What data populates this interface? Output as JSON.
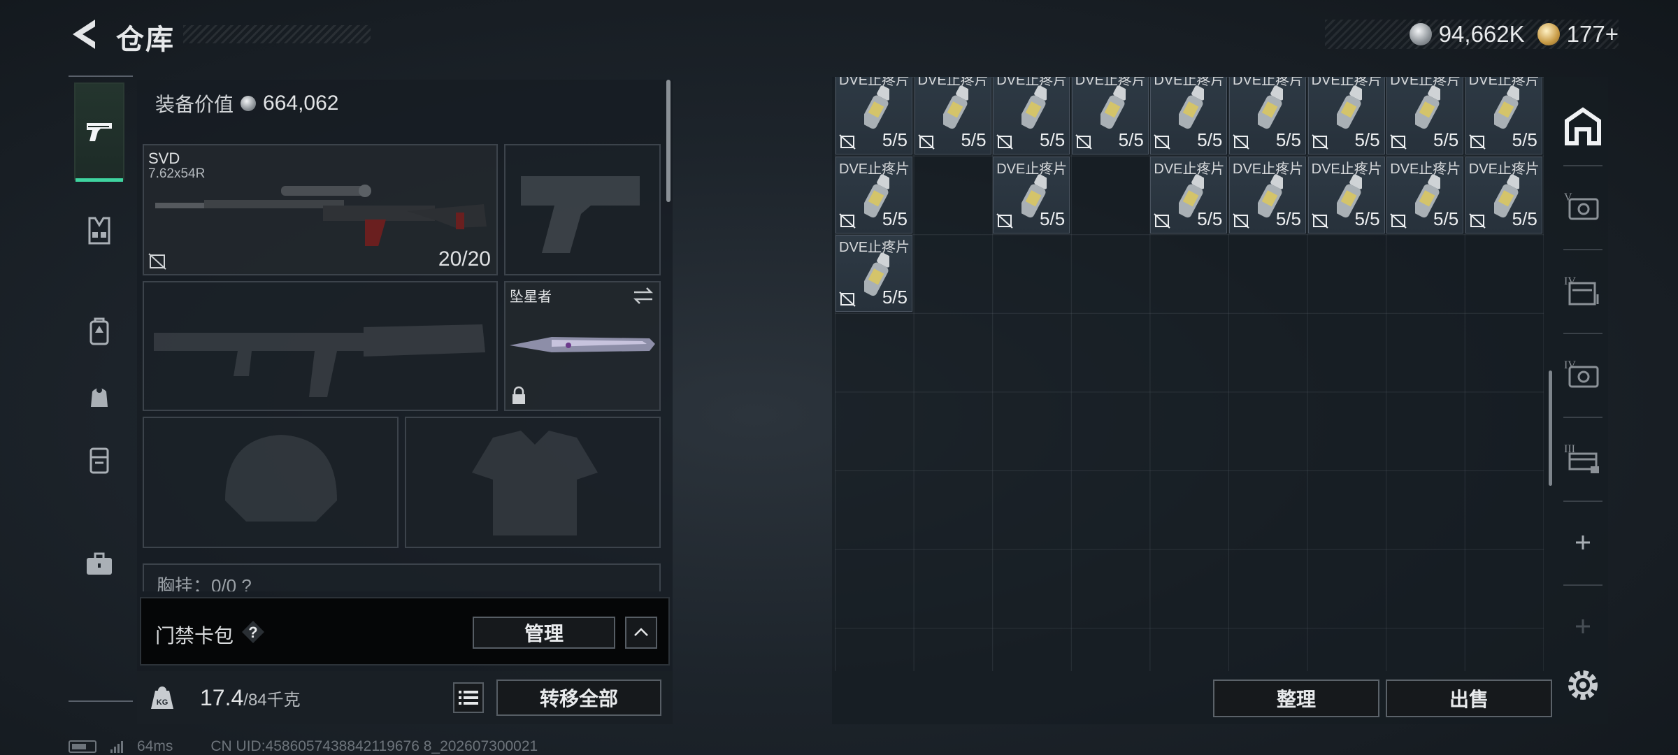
{
  "header": {
    "title": "仓库",
    "currencies": [
      {
        "name": "silver-coin",
        "value": "94,662K"
      },
      {
        "name": "gold-coin",
        "value": "177+"
      }
    ]
  },
  "left_tabs": [
    {
      "name": "weapons",
      "icon": "pistol-icon",
      "active": true
    },
    {
      "name": "armor",
      "icon": "vest-icon",
      "active": false
    },
    {
      "name": "backpack",
      "icon": "backpack-icon",
      "active": false
    },
    {
      "name": "bag",
      "icon": "pouch-icon",
      "active": false
    },
    {
      "name": "container",
      "icon": "case-icon",
      "active": false
    },
    {
      "name": "briefcase",
      "icon": "briefcase-icon",
      "active": false
    }
  ],
  "equipment": {
    "value_label": "装备价值",
    "value": "664,062",
    "primary": {
      "name": "SVD",
      "caliber": "7.62x54R",
      "ammo": "20/20"
    },
    "melee": {
      "name": "坠星者"
    },
    "chest_rig_label": "胸挂：0/0 ?"
  },
  "keycard": {
    "label": "门禁卡包",
    "help": "?",
    "manage_label": "管理"
  },
  "weight": {
    "current": "17.4",
    "max": "/84千克",
    "transfer_label": "转移全部"
  },
  "status": {
    "ping": "64ms",
    "uid": "CN UID:4586057438842119676 8_202607300021"
  },
  "storage": {
    "items": [
      {
        "name": "DVE止疼片",
        "count": "5/5",
        "col": 0,
        "row": 0
      },
      {
        "name": "DVE止疼片",
        "count": "5/5",
        "col": 1,
        "row": 0
      },
      {
        "name": "DVE止疼片",
        "count": "5/5",
        "col": 2,
        "row": 0
      },
      {
        "name": "DVE止疼片",
        "count": "5/5",
        "col": 3,
        "row": 0
      },
      {
        "name": "DVE止疼片",
        "count": "5/5",
        "col": 4,
        "row": 0
      },
      {
        "name": "DVE止疼片",
        "count": "5/5",
        "col": 5,
        "row": 0
      },
      {
        "name": "DVE止疼片",
        "count": "5/5",
        "col": 6,
        "row": 0
      },
      {
        "name": "DVE止疼片",
        "count": "5/5",
        "col": 7,
        "row": 0
      },
      {
        "name": "DVE止疼片",
        "count": "5/5",
        "col": 8,
        "row": 0
      },
      {
        "name": "DVE止疼片",
        "count": "5/5",
        "col": 0,
        "row": 1
      },
      {
        "name": "DVE止疼片",
        "count": "5/5",
        "col": 2,
        "row": 1
      },
      {
        "name": "DVE止疼片",
        "count": "5/5",
        "col": 4,
        "row": 1
      },
      {
        "name": "DVE止疼片",
        "count": "5/5",
        "col": 5,
        "row": 1
      },
      {
        "name": "DVE止疼片",
        "count": "5/5",
        "col": 6,
        "row": 1
      },
      {
        "name": "DVE止疼片",
        "count": "5/5",
        "col": 7,
        "row": 1
      },
      {
        "name": "DVE止疼片",
        "count": "5/5",
        "col": 8,
        "row": 1
      },
      {
        "name": "DVE止疼片",
        "count": "5/5",
        "col": 0,
        "row": 2
      }
    ],
    "sort_label": "整理",
    "sell_label": "出售"
  },
  "right_tabs": [
    {
      "name": "home",
      "icon": "stash-home-icon"
    },
    {
      "name": "tier-v",
      "icon": "tier-v-case-icon"
    },
    {
      "name": "tier-iv-a",
      "icon": "tier-iv-case-icon"
    },
    {
      "name": "tier-iv-b",
      "icon": "tier-iv-case-icon"
    },
    {
      "name": "tier-iii",
      "icon": "tier-iii-case-icon"
    },
    {
      "name": "add",
      "icon": "plus-icon"
    },
    {
      "name": "add-disabled",
      "icon": "plus-icon"
    }
  ],
  "colors": {
    "accent": "#3fd4a0",
    "background": "#1d242b"
  }
}
